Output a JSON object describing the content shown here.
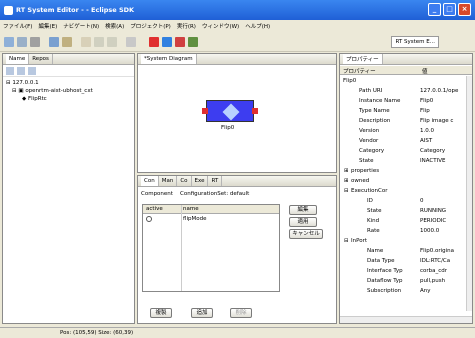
{
  "window": {
    "title": "RT System Editor - - Eclipse SDK"
  },
  "menu": [
    "ファイル(F)",
    "編集(E)",
    "ナビゲート(N)",
    "検索(A)",
    "プロジェクト(P)",
    "実行(R)",
    "ウィンドウ(W)",
    "ヘルプ(H)"
  ],
  "perspective": {
    "label": "RT System E..."
  },
  "left_panel": {
    "tab1": "Name",
    "tab2": "Repos"
  },
  "tree": {
    "root": "127.0.0.1",
    "host": "openrtm-aist-ubhost_cxt",
    "node": "FlipRtc"
  },
  "diagram": {
    "tab": "*System Diagram",
    "component_label": "Flip0"
  },
  "config": {
    "tabs": [
      "Con",
      "Man",
      "Co",
      "Exe",
      "RT"
    ],
    "component_label": "Component",
    "config_set_label": "ConfigurationSet: default",
    "cols": {
      "active": "active",
      "name": "name"
    },
    "row": {
      "name": "flipMode"
    },
    "buttons": {
      "edit": "編集",
      "apply": "適用",
      "cancel": "キャンセル",
      "copy": "複製",
      "add": "追加",
      "delete": "削除"
    }
  },
  "properties": {
    "tab": "プロパティー",
    "col_property": "プロパティー",
    "col_value": "値",
    "rows": [
      {
        "indent": 0,
        "k": "Flip0",
        "v": "",
        "exp": "⊟"
      },
      {
        "indent": 2,
        "k": "Path URI",
        "v": "127.0.0.1/ope"
      },
      {
        "indent": 2,
        "k": "Instance Name",
        "v": "Flip0"
      },
      {
        "indent": 2,
        "k": "Type Name",
        "v": "Flip"
      },
      {
        "indent": 2,
        "k": "Description",
        "v": "Flip image c"
      },
      {
        "indent": 2,
        "k": "Version",
        "v": "1.0.0"
      },
      {
        "indent": 2,
        "k": "Vendor",
        "v": "AIST"
      },
      {
        "indent": 2,
        "k": "Category",
        "v": "Category"
      },
      {
        "indent": 2,
        "k": "State",
        "v": "INACTIVE"
      },
      {
        "indent": 1,
        "k": "properties",
        "v": "",
        "exp": "⊞"
      },
      {
        "indent": 1,
        "k": "owned",
        "v": "",
        "exp": "⊞"
      },
      {
        "indent": 1,
        "k": "ExecutionCor",
        "v": "",
        "exp": "⊟"
      },
      {
        "indent": 3,
        "k": "ID",
        "v": "0"
      },
      {
        "indent": 3,
        "k": "State",
        "v": "RUNNING"
      },
      {
        "indent": 3,
        "k": "Kind",
        "v": "PERIODIC"
      },
      {
        "indent": 3,
        "k": "Rate",
        "v": "1000.0"
      },
      {
        "indent": 1,
        "k": "InPort",
        "v": "",
        "exp": "⊟"
      },
      {
        "indent": 3,
        "k": "Name",
        "v": "Flip0.origina"
      },
      {
        "indent": 3,
        "k": "Data Type",
        "v": "IDL:RTC/Ca"
      },
      {
        "indent": 3,
        "k": "Interface Typ",
        "v": "corba_cdr"
      },
      {
        "indent": 3,
        "k": "Dataflow Typ",
        "v": "pull,push"
      },
      {
        "indent": 3,
        "k": "Subscription",
        "v": "Any"
      }
    ]
  },
  "status": {
    "text": "Pos: (105,59) Size: (60,39)"
  }
}
